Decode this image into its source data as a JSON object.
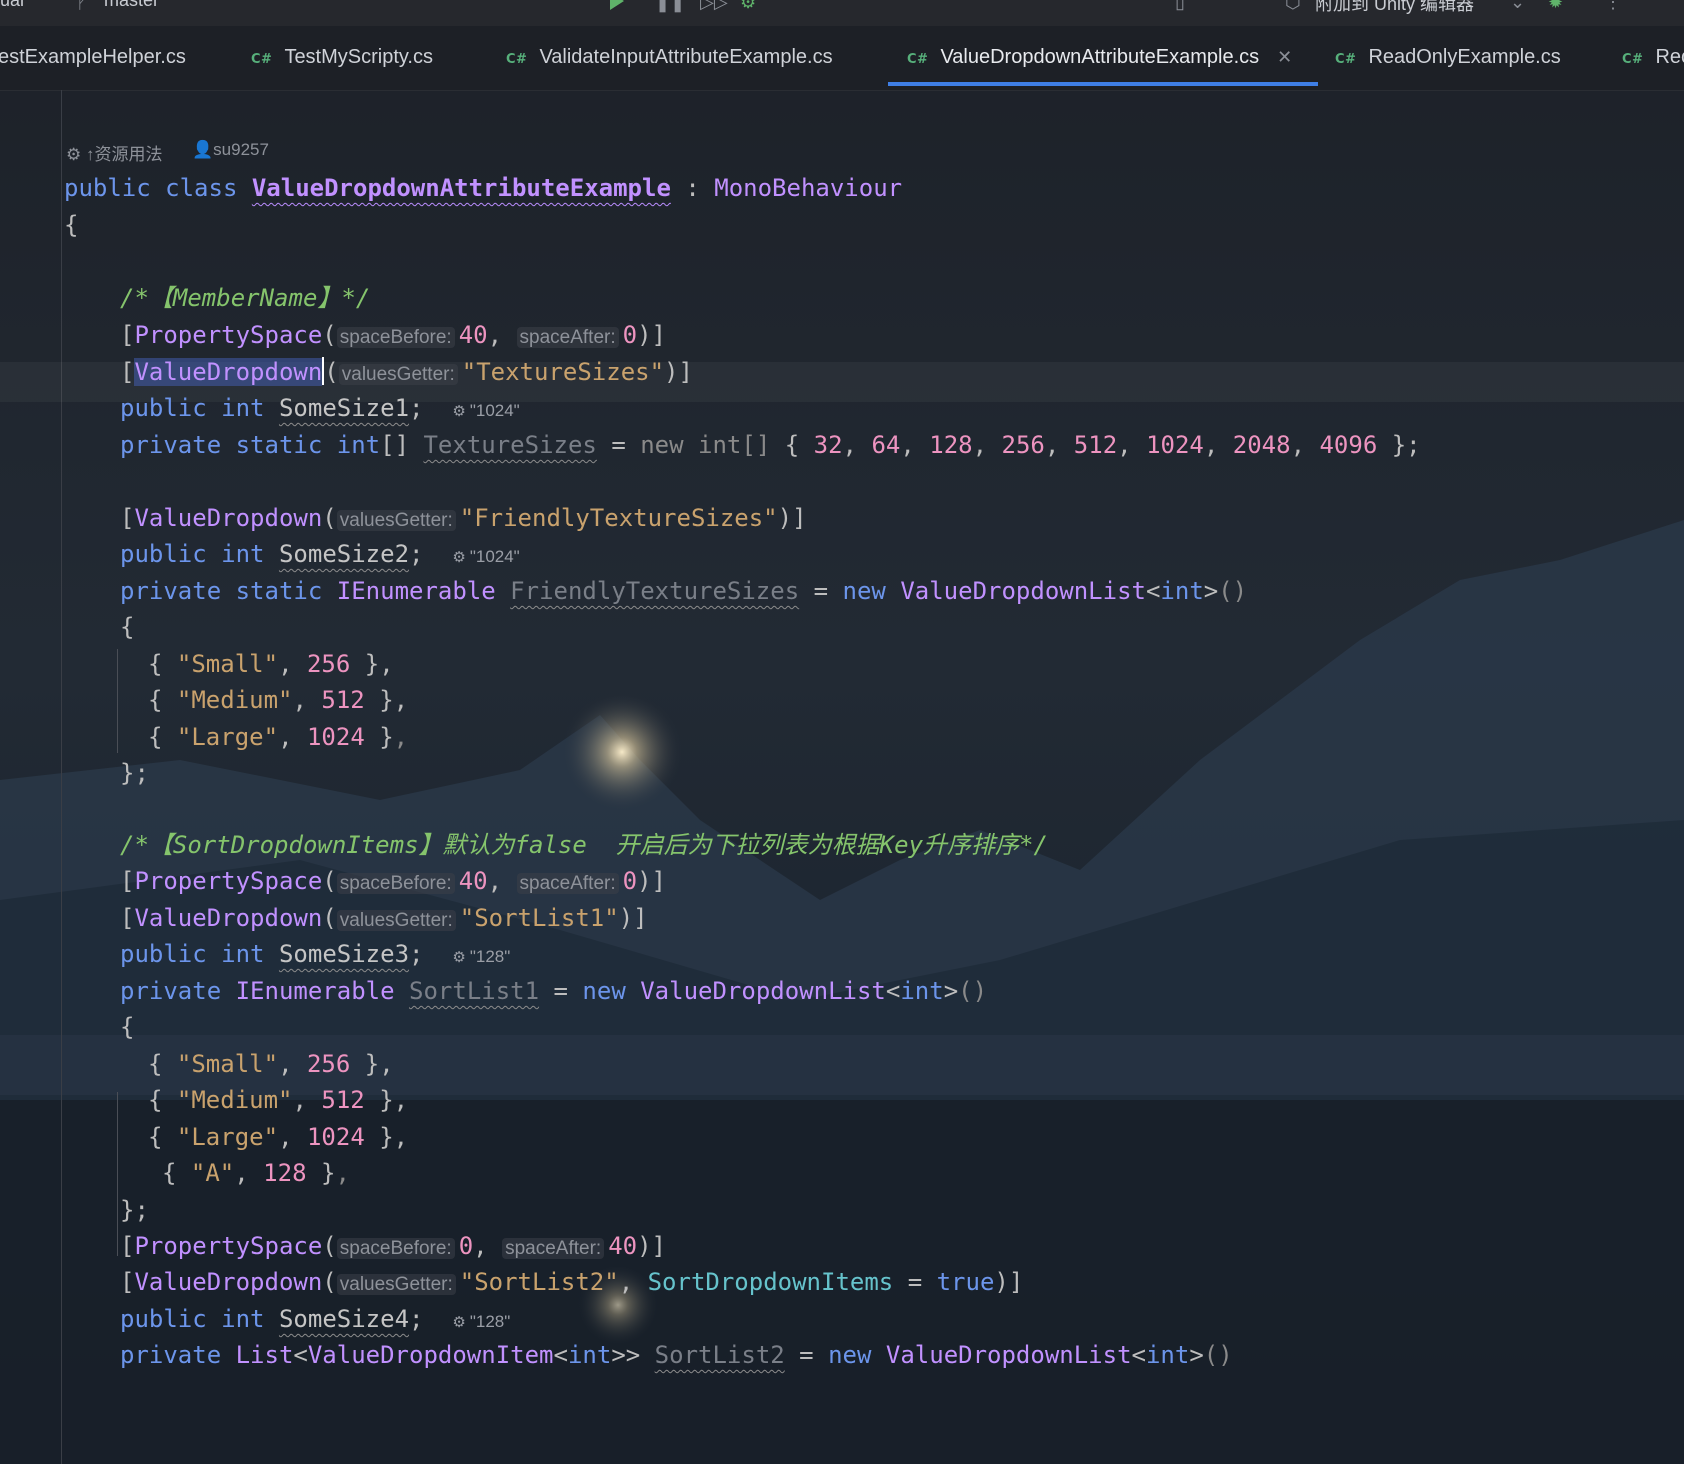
{
  "topbar": {
    "left_text": "ual",
    "branch_icon": "branch-icon",
    "branch": "master",
    "attach_label": "附加到 Unity 编辑器"
  },
  "tabs": [
    {
      "label": "estExampleHelper.cs",
      "lang": "",
      "active": false
    },
    {
      "label": "TestMyScripty.cs",
      "lang": "C#",
      "active": false
    },
    {
      "label": "ValidateInputAttributeExample.cs",
      "lang": "C#",
      "active": false
    },
    {
      "label": "ValueDropdownAttributeExample.cs",
      "lang": "C#",
      "active": true
    },
    {
      "label": "ReadOnlyExample.cs",
      "lang": "C#",
      "active": false
    },
    {
      "label": "Rec",
      "lang": "C#",
      "active": false
    }
  ],
  "editor": {
    "meta": {
      "usages": "↑资源用法",
      "author": "su9257"
    },
    "class_decl": {
      "public": "public",
      "class": "class",
      "name": "ValueDropdownAttributeExample",
      "colon": ":",
      "base": "MonoBehaviour"
    },
    "comment1": "/*【MemberName】*/",
    "comment2": "/*【SortDropdownItems】默认为false  开启后为下拉列表为根据Key升序排序*/",
    "hints": {
      "spaceBefore": "spaceBefore:",
      "spaceAfter": "spaceAfter:",
      "valuesGetter": "valuesGetter:"
    },
    "inlays": [
      "\"1024\"",
      "\"1024\"",
      "\"128\"",
      "\"128\""
    ],
    "texture_sizes": [
      "32",
      "64",
      "128",
      "256",
      "512",
      "1024",
      "2048",
      "4096"
    ],
    "list_items": [
      {
        "key": "\"Small\"",
        "value": "256"
      },
      {
        "key": "\"Medium\"",
        "value": "512"
      },
      {
        "key": "\"Large\"",
        "value": "1024"
      },
      {
        "key": "\"A\"",
        "value": "128"
      }
    ]
  }
}
